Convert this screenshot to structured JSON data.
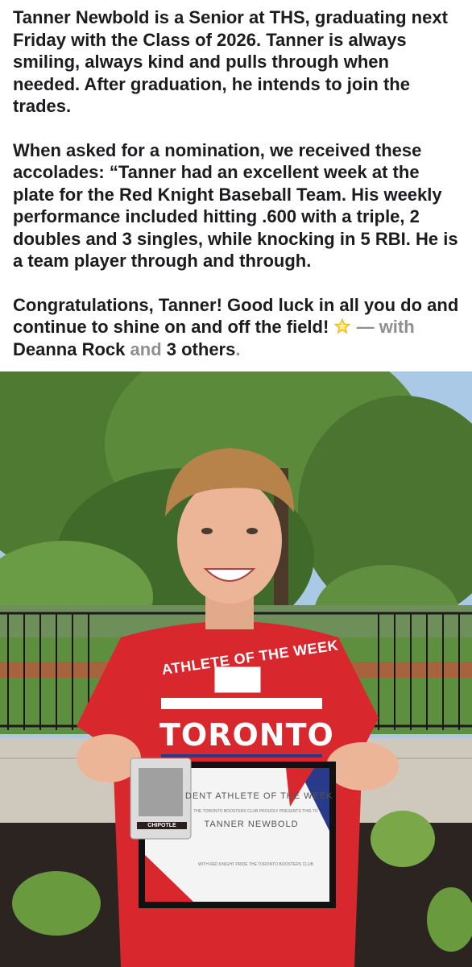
{
  "post": {
    "paragraph1": "Tanner Newbold is a Senior at THS, graduating next Friday with the Class of 2026. Tanner is always smiling, always kind and pulls through when needed. After graduation, he intends to join the trades.",
    "paragraph2": "When asked for a nomination, we received these accolades: “Tanner had an excellent week at the plate for the Red Knight Baseball Team. His weekly performance included hitting .600 with a triple, 2 doubles and 3 singles, while knocking in 5 RBI. He is a team player through and through.",
    "paragraph3": "Congratulations, Tanner! Good luck in all you do and continue to shine on and off the field!",
    "emoji_icon": "glowing-star-icon",
    "dash": "—",
    "with_label": "with",
    "tagged_person": "Deanna Rock",
    "and_label": "and",
    "others_label": "3 others",
    "period": "."
  },
  "photo": {
    "shirt_line1": "ATHLETE OF THE WEEK",
    "shirt_line2": "TORONTO",
    "certificate_title": "DENT ATHLETE OF THE WEEK",
    "certificate_presenter": "THE TORONTO BOOSTERS CLUB PROUDLY PRESENTS THIS TO",
    "certificate_name": "TANNER NEWBOLD",
    "certificate_footer": "WITH RED KNIGHT PRIDE THE TORONTO BOOSTERS CLUB",
    "gift_card_brand": "CHIPOTLE"
  }
}
